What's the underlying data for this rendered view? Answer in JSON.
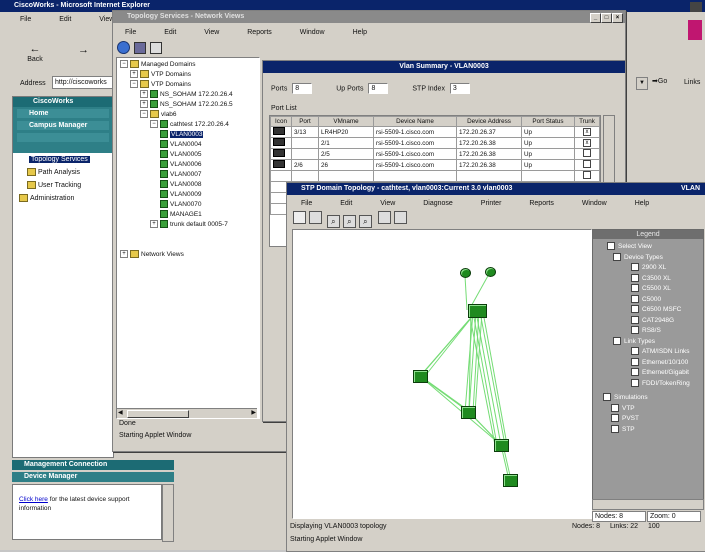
{
  "browser": {
    "title": "CiscoWorks - Microsoft Internet Explorer",
    "menu": [
      "File",
      "Edit",
      "View",
      "Go"
    ],
    "back_label": "Back",
    "address_label": "Address",
    "address_value": "http://ciscoworks",
    "go_label": "Go",
    "links_label": "Links"
  },
  "left_panel": {
    "header": "CiscoWorks",
    "items": [
      "Home",
      "Campus Manager",
      "Topology Services",
      "Path Analysis",
      "User Tracking",
      "Administration"
    ],
    "selected_index": 3,
    "bottom_header_1": "Management Connection",
    "bottom_header_2": "Device Manager",
    "bottom_text_link": "Click here",
    "bottom_text": " for the latest device support information"
  },
  "topo_window": {
    "title": "Topology Services - Network Views",
    "menu": [
      "File",
      "Edit",
      "View",
      "Reports",
      "Window",
      "Help"
    ],
    "tree": [
      {
        "label": "Managed Domains",
        "level": 0,
        "type": "folder"
      },
      {
        "label": "VTP Domains",
        "level": 1,
        "type": "folder"
      },
      {
        "label": "VTP Domains",
        "level": 1,
        "type": "folder"
      },
      {
        "label": "NS_SOHAM 172.20.26.4",
        "level": 2,
        "type": "device"
      },
      {
        "label": "NS_SOHAM 172.20.26.5",
        "level": 2,
        "type": "device"
      },
      {
        "label": "vlab6",
        "level": 2,
        "type": "folder"
      },
      {
        "label": "cathtest 172.20.26.4",
        "level": 3,
        "type": "device"
      },
      {
        "label": "VLAN0003",
        "level": 4,
        "type": "device",
        "selected": true
      },
      {
        "label": "VLAN0004",
        "level": 4,
        "type": "device"
      },
      {
        "label": "VLAN0005",
        "level": 4,
        "type": "device"
      },
      {
        "label": "VLAN0006",
        "level": 4,
        "type": "device"
      },
      {
        "label": "VLAN0007",
        "level": 4,
        "type": "device"
      },
      {
        "label": "VLAN0008",
        "level": 4,
        "type": "device"
      },
      {
        "label": "VLAN0009",
        "level": 4,
        "type": "device"
      },
      {
        "label": "VLAN0070",
        "level": 4,
        "type": "device"
      },
      {
        "label": "MANAGE1",
        "level": 4,
        "type": "device"
      },
      {
        "label": "trunk default 0005-7",
        "level": 3,
        "type": "device"
      },
      {
        "label": "Network Views",
        "level": 0,
        "type": "folder"
      }
    ],
    "status_1": "Done",
    "status_2": "Starting Applet Window"
  },
  "vlan_window": {
    "title": "Vlan Summary - VLAN0003",
    "fields": [
      {
        "label": "Ports",
        "value": "8"
      },
      {
        "label": "Up Ports",
        "value": "8"
      },
      {
        "label": "STP Index",
        "value": "3"
      }
    ],
    "section_label": "Port List",
    "columns": [
      "Icon",
      "Port",
      "VMname",
      "Device Name",
      "Device Address",
      "Port Status",
      "Trunk"
    ],
    "rows": [
      [
        "",
        "3/13",
        "LR4HP20",
        "rsi-5509-1.cisco.com",
        "172.20.26.37",
        "Up",
        "x"
      ],
      [
        "",
        "",
        "2/1",
        "rsi-5509-1.cisco.com",
        "172.20.26.38",
        "Up",
        "x"
      ],
      [
        "",
        "",
        "2/5",
        "rsi-5509-1.cisco.com",
        "172.20.26.38",
        "Up",
        ""
      ],
      [
        "",
        "2/6",
        "26",
        "rsi-5509-1.cisco.com",
        "172.20.26.38",
        "Up",
        ""
      ],
      [
        "",
        "",
        "",
        "",
        "",
        "",
        ""
      ],
      [
        "",
        "",
        "",
        "",
        "",
        "",
        ""
      ],
      [
        "",
        "",
        "",
        "",
        "",
        "",
        ""
      ],
      [
        "",
        "",
        "",
        "",
        "",
        "",
        ""
      ]
    ]
  },
  "stp_window": {
    "title": "STP Domain Topology - cathtest, vlan0003:Current 3.0 vlan0003",
    "title_right": "VLAN",
    "menu": [
      "File",
      "Edit",
      "View",
      "Diagnose",
      "Printer",
      "Reports",
      "Window",
      "Help"
    ],
    "legend": {
      "title": "Legend",
      "root": "Select View",
      "groups": [
        {
          "label": "Device Types",
          "items": [
            "2900 XL",
            "C3500 XL",
            "C5500 XL",
            "C5000",
            "C6500 MSFC",
            "CAT2948G",
            "RS8/S"
          ]
        },
        {
          "label": "Link Types",
          "items": [
            "ATM/ISDN Links",
            "Ethernet/10/100",
            "Ethernet/Gigabit",
            "FDDI/TokenRing"
          ]
        },
        {
          "label": "Simulations",
          "items": [
            "VTP",
            "PVST",
            "STP"
          ]
        }
      ]
    },
    "zoom_field_1": "Nodes: 8",
    "zoom_field_2": "Zoom: 0",
    "status_1": "Displaying VLAN0003 topology",
    "status_2": "Starting Applet Window",
    "status_right_1": "Nodes: 8",
    "status_right_2": "Links: 22",
    "status_right_3": "100"
  },
  "colors": {
    "titlebar": "#0a246a",
    "link_green": "#55dd55",
    "node_green": "#1f8a1f",
    "panel_teal": "#1c6b74"
  }
}
